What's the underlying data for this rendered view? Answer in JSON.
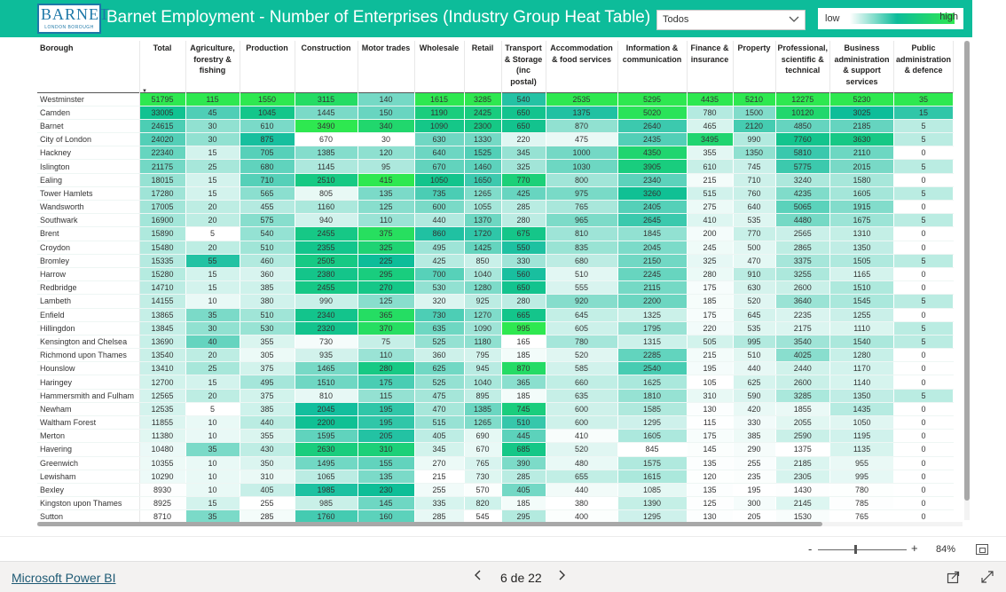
{
  "header": {
    "logo_text": "BARNET",
    "logo_subtext": "LONDON BOROUGH",
    "title": "Barnet Employment - Number of Enterprises (Industry Group Heat Table)",
    "filter_value": "Todos",
    "legend_low": "low",
    "legend_high": "high",
    "colors": {
      "header_bg": "#0dbc9a",
      "low": "#ffffff",
      "mid": "#0dbc9a",
      "high": "#2ee850"
    }
  },
  "table": {
    "columns": [
      "Borough",
      "Total",
      "Agriculture, forestry & fishing",
      "Production",
      "Construction",
      "Motor trades",
      "Wholesale",
      "Retail",
      "Transport & Storage (inc postal)",
      "Accommodation & food services",
      "Information & communication",
      "Finance & insurance",
      "Property",
      "Professional, scientific & technical",
      "Business administration & support services",
      "Public administration & defence"
    ],
    "rows": [
      [
        "Westminster",
        "51795",
        "115",
        "1550",
        "3115",
        "140",
        "1615",
        "3285",
        "540",
        "2535",
        "5295",
        "4435",
        "5210",
        "12275",
        "5230",
        "35"
      ],
      [
        "Camden",
        "33005",
        "45",
        "1045",
        "1445",
        "150",
        "1190",
        "2425",
        "650",
        "1375",
        "5020",
        "780",
        "1500",
        "10120",
        "3025",
        "15"
      ],
      [
        "Barnet",
        "24615",
        "30",
        "610",
        "3490",
        "340",
        "1090",
        "2300",
        "650",
        "870",
        "2640",
        "465",
        "2120",
        "4850",
        "2185",
        "5"
      ],
      [
        "City of London",
        "24020",
        "30",
        "875",
        "670",
        "30",
        "630",
        "1330",
        "220",
        "475",
        "2435",
        "3495",
        "990",
        "7760",
        "3630",
        "5"
      ],
      [
        "Hackney",
        "22340",
        "15",
        "705",
        "1385",
        "120",
        "640",
        "1525",
        "345",
        "1000",
        "4350",
        "355",
        "1350",
        "5810",
        "2110",
        "0"
      ],
      [
        "Islington",
        "21175",
        "25",
        "680",
        "1145",
        "95",
        "670",
        "1460",
        "325",
        "1030",
        "3905",
        "610",
        "745",
        "5775",
        "2015",
        "5"
      ],
      [
        "Ealing",
        "18015",
        "15",
        "710",
        "2510",
        "415",
        "1050",
        "1650",
        "770",
        "800",
        "2340",
        "215",
        "710",
        "3240",
        "1580",
        "0"
      ],
      [
        "Tower Hamlets",
        "17280",
        "15",
        "565",
        "805",
        "135",
        "735",
        "1265",
        "425",
        "975",
        "3260",
        "515",
        "760",
        "4235",
        "1605",
        "5"
      ],
      [
        "Wandsworth",
        "17005",
        "20",
        "455",
        "1160",
        "125",
        "600",
        "1055",
        "285",
        "765",
        "2405",
        "275",
        "640",
        "5065",
        "1915",
        "0"
      ],
      [
        "Southwark",
        "16900",
        "20",
        "575",
        "940",
        "110",
        "440",
        "1370",
        "280",
        "965",
        "2645",
        "410",
        "535",
        "4480",
        "1675",
        "5"
      ],
      [
        "Brent",
        "15890",
        "5",
        "540",
        "2455",
        "375",
        "860",
        "1720",
        "675",
        "810",
        "1845",
        "200",
        "770",
        "2565",
        "1310",
        "0"
      ],
      [
        "Croydon",
        "15480",
        "20",
        "510",
        "2355",
        "325",
        "495",
        "1425",
        "550",
        "835",
        "2045",
        "245",
        "500",
        "2865",
        "1350",
        "0"
      ],
      [
        "Bromley",
        "15335",
        "55",
        "460",
        "2505",
        "225",
        "425",
        "850",
        "330",
        "680",
        "2150",
        "325",
        "470",
        "3375",
        "1505",
        "5"
      ],
      [
        "Harrow",
        "15280",
        "15",
        "360",
        "2380",
        "295",
        "700",
        "1040",
        "560",
        "510",
        "2245",
        "280",
        "910",
        "3255",
        "1165",
        "0"
      ],
      [
        "Redbridge",
        "14710",
        "15",
        "385",
        "2455",
        "270",
        "530",
        "1280",
        "650",
        "555",
        "2115",
        "175",
        "630",
        "2600",
        "1510",
        "0"
      ],
      [
        "Lambeth",
        "14155",
        "10",
        "380",
        "990",
        "125",
        "320",
        "925",
        "280",
        "920",
        "2200",
        "185",
        "520",
        "3640",
        "1545",
        "5"
      ],
      [
        "Enfield",
        "13865",
        "35",
        "510",
        "2340",
        "365",
        "730",
        "1270",
        "665",
        "645",
        "1325",
        "175",
        "645",
        "2235",
        "1255",
        "0"
      ],
      [
        "Hillingdon",
        "13845",
        "30",
        "530",
        "2320",
        "370",
        "635",
        "1090",
        "995",
        "605",
        "1795",
        "220",
        "535",
        "2175",
        "1110",
        "5"
      ],
      [
        "Kensington and Chelsea",
        "13690",
        "40",
        "355",
        "730",
        "75",
        "525",
        "1180",
        "165",
        "780",
        "1315",
        "505",
        "995",
        "3540",
        "1540",
        "5"
      ],
      [
        "Richmond upon Thames",
        "13540",
        "20",
        "305",
        "935",
        "110",
        "360",
        "795",
        "185",
        "520",
        "2285",
        "215",
        "510",
        "4025",
        "1280",
        "0"
      ],
      [
        "Hounslow",
        "13410",
        "25",
        "375",
        "1465",
        "280",
        "625",
        "945",
        "870",
        "585",
        "2540",
        "195",
        "440",
        "2440",
        "1170",
        "0"
      ],
      [
        "Haringey",
        "12700",
        "15",
        "495",
        "1510",
        "175",
        "525",
        "1040",
        "365",
        "660",
        "1625",
        "105",
        "625",
        "2600",
        "1140",
        "0"
      ],
      [
        "Hammersmith and Fulham",
        "12565",
        "20",
        "375",
        "810",
        "115",
        "475",
        "895",
        "185",
        "635",
        "1810",
        "310",
        "590",
        "3285",
        "1350",
        "5"
      ],
      [
        "Newham",
        "12535",
        "5",
        "385",
        "2045",
        "195",
        "470",
        "1385",
        "745",
        "600",
        "1585",
        "130",
        "420",
        "1855",
        "1435",
        "0"
      ],
      [
        "Waltham Forest",
        "11855",
        "10",
        "440",
        "2200",
        "195",
        "515",
        "1265",
        "510",
        "600",
        "1295",
        "115",
        "330",
        "2055",
        "1050",
        "0"
      ],
      [
        "Merton",
        "11380",
        "10",
        "355",
        "1595",
        "205",
        "405",
        "690",
        "445",
        "410",
        "1605",
        "175",
        "385",
        "2590",
        "1195",
        "0"
      ],
      [
        "Havering",
        "10480",
        "35",
        "430",
        "2630",
        "310",
        "345",
        "670",
        "685",
        "520",
        "845",
        "145",
        "290",
        "1375",
        "1135",
        "0"
      ],
      [
        "Greenwich",
        "10355",
        "10",
        "350",
        "1495",
        "155",
        "270",
        "765",
        "390",
        "480",
        "1575",
        "135",
        "255",
        "2185",
        "955",
        "0"
      ],
      [
        "Lewisham",
        "10290",
        "10",
        "310",
        "1065",
        "135",
        "215",
        "730",
        "285",
        "655",
        "1615",
        "120",
        "235",
        "2305",
        "995",
        "0"
      ],
      [
        "Bexley",
        "8930",
        "10",
        "405",
        "1985",
        "230",
        "255",
        "570",
        "405",
        "440",
        "1085",
        "135",
        "195",
        "1430",
        "780",
        "0"
      ],
      [
        "Kingston upon Thames",
        "8925",
        "15",
        "255",
        "985",
        "145",
        "335",
        "820",
        "185",
        "380",
        "1390",
        "125",
        "300",
        "2145",
        "785",
        "0"
      ],
      [
        "Sutton",
        "8710",
        "35",
        "285",
        "1760",
        "160",
        "285",
        "545",
        "295",
        "400",
        "1295",
        "130",
        "205",
        "1530",
        "765",
        "0"
      ]
    ]
  },
  "zoom": {
    "minus": "-",
    "plus": "+",
    "level": "84%",
    "fraction": 0.42
  },
  "footer": {
    "brand_link": "Microsoft Power BI",
    "page_indicator": "6 de 22",
    "prev_icon": "chevron-left-icon",
    "next_icon": "chevron-right-icon"
  }
}
